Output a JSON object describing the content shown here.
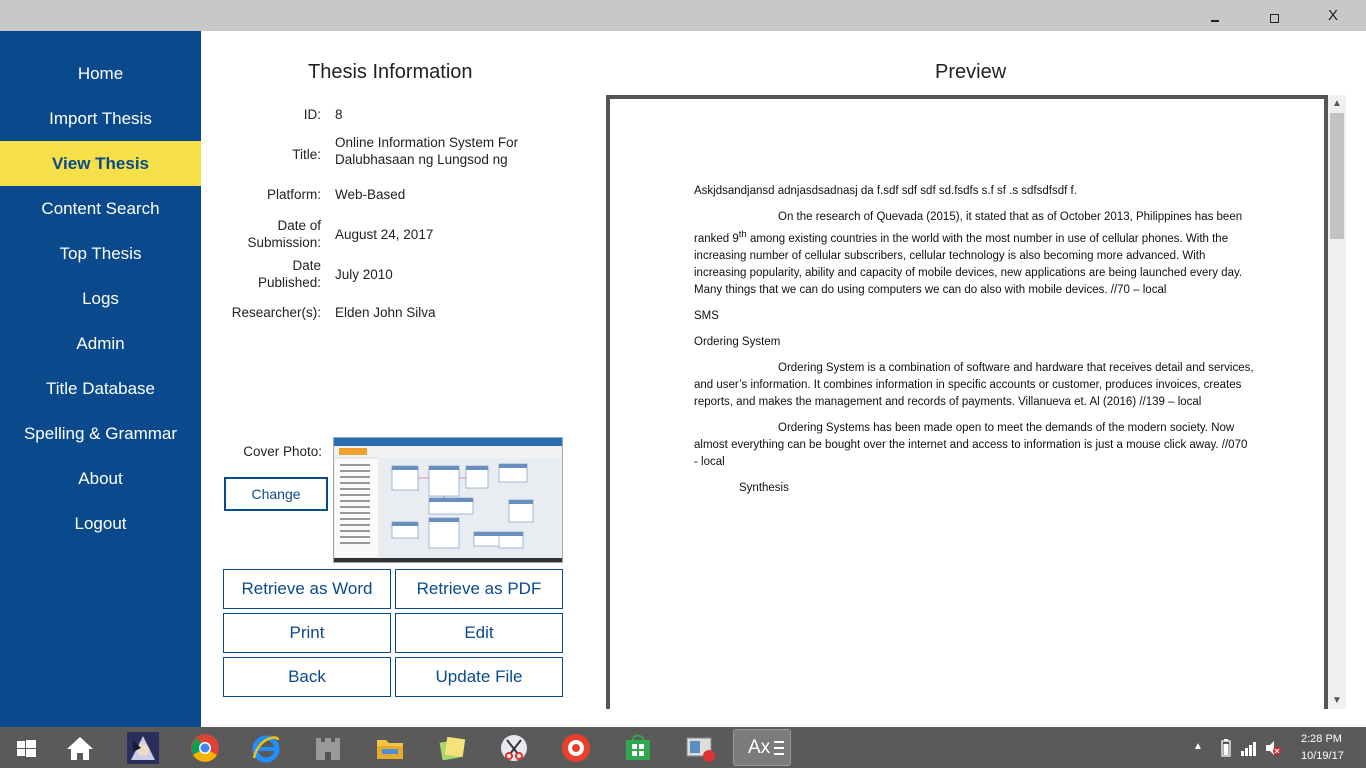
{
  "window": {
    "minimize_label": "",
    "maximize_label": "",
    "close_label": "X"
  },
  "sidebar": {
    "items": [
      {
        "label": "Home"
      },
      {
        "label": "Import Thesis"
      },
      {
        "label": "View Thesis",
        "active": true
      },
      {
        "label": "Content Search"
      },
      {
        "label": "Top Thesis"
      },
      {
        "label": "Logs"
      },
      {
        "label": "Admin"
      },
      {
        "label": "Title Database"
      },
      {
        "label": "Spelling & Grammar"
      },
      {
        "label": "About"
      },
      {
        "label": "Logout"
      }
    ]
  },
  "thesis": {
    "heading": "Thesis Information",
    "id_label": "ID:",
    "id_value": "8",
    "title_label": "Title:",
    "title_value": "Online Information System For Dalubhasaan ng Lungsod ng",
    "platform_label": "Platform:",
    "platform_value": "Web-Based",
    "submission_label": "Date of Submission:",
    "submission_value": "August 24, 2017",
    "published_label": "Date Published:",
    "published_value": "July 2010",
    "researchers_label": "Researcher(s):",
    "researchers_value": "Elden John Silva",
    "cover_label": "Cover Photo:",
    "change_label": "Change"
  },
  "actions": {
    "retrieve_word": "Retrieve as Word",
    "retrieve_pdf": "Retrieve as PDF",
    "print": "Print",
    "edit": "Edit",
    "back": "Back",
    "update_file": "Update File"
  },
  "preview": {
    "heading": "Preview",
    "p1": "Askjdsandjansd adnjasdsadnasj da f.sdf sdf sdf sd.fsdfs s.f sf .s sdfsdfsdf f.",
    "p2_a": "On the research of Quevada (2015), it stated that as of October 2013, Philippines has been ranked 9",
    "p2_sup": "th",
    "p2_b": " among existing countries in the world with the most number in use of cellular phones. With the increasing number of cellular subscribers, cellular technology is also becoming more advanced. With increasing popularity, ability and capacity of mobile devices, new applications are being launched every day. Many things that we can do using computers we can do also with mobile devices. //70 – local",
    "p3": "SMS",
    "p4": "Ordering System",
    "p5": "Ordering System is a combination of software and hardware that receives detail and services, and user’s information. It combines information in specific accounts or customer, produces invoices, creates reports, and makes the management and records of payments. Villanueva et. Al (2016) //139 – local",
    "p6": "Ordering Systems has been made open to meet the demands of the modern society. Now almost everything can be bought over the internet and access to information is just a mouse click away. //070 - local",
    "p7": "Synthesis"
  },
  "taskbar": {
    "active_app_label": "Ax",
    "time": "2:28 PM",
    "date": "10/19/17"
  }
}
